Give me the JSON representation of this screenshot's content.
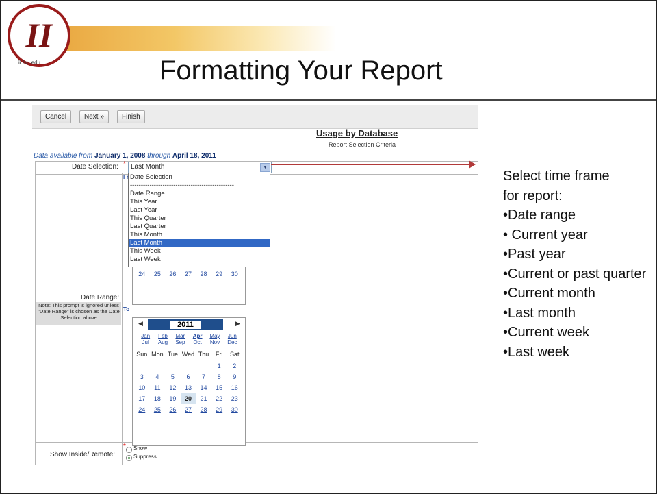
{
  "slide": {
    "logo_text": "II",
    "logo_url": "ii.fsu.edu",
    "title": "Formatting Your Report"
  },
  "toolbar": {
    "cancel": "Cancel",
    "next": "Next »",
    "finish": "Finish"
  },
  "report": {
    "title": "Usage by Database",
    "subtitle": "Report Selection Criteria",
    "avail_prefix": "Data available from",
    "avail_from": "January 1, 2008",
    "avail_through_word": "through",
    "avail_to": "April 18, 2011"
  },
  "date_selection": {
    "label": "Date Selection:",
    "value": "Last Month",
    "options": [
      "Date Selection",
      "------------------------------------------------",
      "Date Range",
      "This Year",
      "Last Year",
      "This Quarter",
      "Last Quarter",
      "This Month",
      "Last Month",
      "This Week",
      "Last Week"
    ],
    "selected_index": 8
  },
  "date_range": {
    "label": "Date Range:",
    "note": "Note: This prompt is ignored unless \"Date Range\" is chosen as the Date Selection above",
    "from_label": "Fr",
    "to_label": "To"
  },
  "calendar_upper": {
    "last_row": [
      "24",
      "25",
      "26",
      "27",
      "28",
      "29",
      "30"
    ]
  },
  "calendar_lower": {
    "prev": "◀",
    "next": "▶",
    "year": "2011",
    "months": [
      "Jan",
      "Feb",
      "Mar",
      "Apr",
      "May",
      "Jun",
      "Jul",
      "Aug",
      "Sep",
      "Oct",
      "Nov",
      "Dec"
    ],
    "weekdays": [
      "Sun",
      "Mon",
      "Tue",
      "Wed",
      "Thu",
      "Fri",
      "Sat"
    ],
    "rows": [
      [
        "",
        "",
        "",
        "",
        "",
        "1",
        "2"
      ],
      [
        "3",
        "4",
        "5",
        "6",
        "7",
        "8",
        "9"
      ],
      [
        "10",
        "11",
        "12",
        "13",
        "14",
        "15",
        "16"
      ],
      [
        "17",
        "18",
        "19",
        "20",
        "21",
        "22",
        "23"
      ],
      [
        "24",
        "25",
        "26",
        "27",
        "28",
        "29",
        "30"
      ]
    ],
    "today": "20"
  },
  "show_inside": {
    "label": "Show Inside/Remote:",
    "show": "Show",
    "suppress": "Suppress"
  },
  "sidebar": {
    "intro": "Select time frame for report:",
    "bullets": [
      "•Date range",
      "• Current year",
      "•Past year",
      "•Current or past quarter",
      "•Current month",
      "•Last month",
      "•Current week",
      "•Last week"
    ]
  }
}
